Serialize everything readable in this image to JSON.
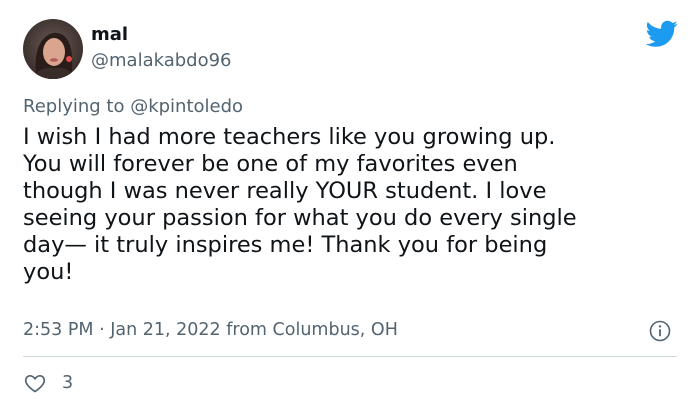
{
  "author": {
    "display_name": "mal",
    "handle": "@malakabdo96",
    "avatar_icon": "user-avatar-photo"
  },
  "brand": {
    "icon": "twitter-bird-icon",
    "color": "#1d9bf0"
  },
  "reply": {
    "prefix": "Replying to ",
    "mention": "@kpintoledo"
  },
  "tweet": {
    "text": "I wish I had more teachers like you growing up.\nYou will forever be one of my favorites even\nthough I was never really YOUR student. I love\nseeing your passion for what you do every single\nday— it truly inspires me! Thank you for being\nyou!"
  },
  "meta": {
    "time": "2:53 PM",
    "separator": " · ",
    "date": "Jan 21, 2022",
    "location_prefix": " from ",
    "location": "Columbus, OH",
    "info_icon": "info-icon"
  },
  "engagement": {
    "likes_count": "3",
    "like_icon": "heart-outline-icon"
  },
  "colors": {
    "text_primary": "#0f1419",
    "text_secondary": "#536471",
    "divider": "#cfd9de",
    "background": "#ffffff"
  }
}
